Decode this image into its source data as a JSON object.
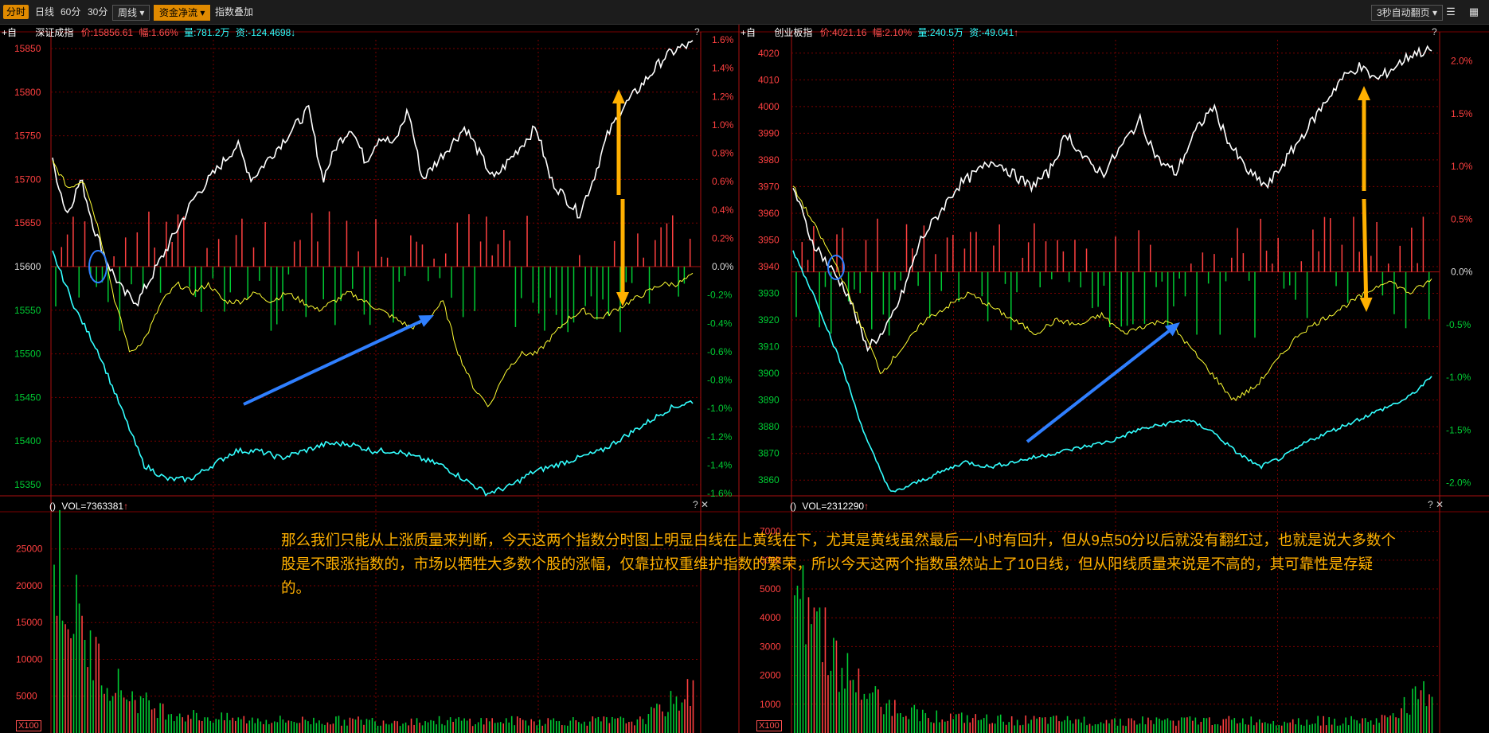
{
  "toolbar": {
    "tabs": [
      "分时",
      "日线",
      "60分",
      "30分"
    ],
    "weekly": "周线",
    "fundflow": "资金净流",
    "overlay": "指数叠加",
    "autopage": "3秒自动翻页"
  },
  "colors": {
    "price": "#ffffff",
    "avg": "#ffff33",
    "breadth": "#33ffff",
    "up": "#ff4040",
    "down": "#00cc33",
    "arrow_blue": "#2f7fff",
    "arrow_orange": "#ffb000",
    "grid": "#7a0000"
  },
  "left": {
    "header_btn": "+自",
    "name": "深证成指",
    "price": "价:15856.61",
    "change": "幅:1.66%",
    "volume": "量:781.2万",
    "fund": "资:-124.4698",
    "fund_arrow": "↓",
    "vol_label": "VOL=7363381",
    "vol_arrow": "↑",
    "y_ticks": [
      "15850",
      "15800",
      "15750",
      "15700",
      "15650",
      "15600",
      "15550",
      "15500",
      "15450",
      "15400",
      "15350"
    ],
    "pct_ticks": [
      "1.6%",
      "1.4%",
      "1.2%",
      "1.0%",
      "0.8%",
      "0.6%",
      "0.4%",
      "0.2%",
      "0.0%",
      "-0.2%",
      "-0.4%",
      "-0.6%",
      "-0.8%",
      "-1.0%",
      "-1.2%",
      "-1.4%",
      "-1.6%"
    ],
    "vol_ticks": [
      "25000",
      "20000",
      "15000",
      "10000",
      "5000"
    ],
    "vol_unit": "X100"
  },
  "right": {
    "header_btn": "+自",
    "name": "创业板指",
    "price": "价:4021.16",
    "change": "幅:2.10%",
    "volume": "量:240.5万",
    "fund": "资:-49.041",
    "fund_arrow": "↑",
    "vol_label": "VOL=2312290",
    "vol_arrow": "↑",
    "y_ticks": [
      "4020",
      "4010",
      "4000",
      "3990",
      "3980",
      "3970",
      "3960",
      "3950",
      "3940",
      "3930",
      "3920",
      "3910",
      "3900",
      "3890",
      "3880",
      "3870",
      "3860"
    ],
    "pct_ticks": [
      "2.0%",
      "1.5%",
      "1.0%",
      "0.5%",
      "0.0%",
      "-0.5%",
      "-1.0%",
      "-1.5%",
      "-2.0%"
    ],
    "vol_ticks": [
      "7000",
      "6000",
      "5000",
      "4000",
      "3000",
      "2000",
      "1000"
    ],
    "vol_unit": "X100"
  },
  "annotation": "那么我们只能从上涨质量来判断，今天这两个指数分时图上明显白线在上黄线在下，尤其是黄线虽然最后一小时有回升，但从9点50分以后就没有翻红过，也就是说大多数个股是不跟涨指数的，市场以牺牲大多数个股的涨幅，仅靠拉权重维护指数的繁荣，所以今天这两个指数虽然站上了10日线，但从阳线质量来说是不高的，其可靠性是存疑的。",
  "chart_data": [
    {
      "type": "line",
      "title": "深证成指",
      "ylim": [
        15340,
        15860
      ],
      "ylim_pct": [
        -1.6,
        1.6
      ],
      "base": 15600,
      "series": [
        {
          "color_key": "price",
          "values": [
            15720,
            15660,
            15700,
            15640,
            15600,
            15570,
            15560,
            15590,
            15620,
            15650,
            15680,
            15700,
            15720,
            15740,
            15700,
            15720,
            15740,
            15760,
            15780,
            15700,
            15740,
            15760,
            15720,
            15750,
            15740,
            15780,
            15700,
            15720,
            15740,
            15760,
            15730,
            15700,
            15720,
            15740,
            15760,
            15700,
            15680,
            15660,
            15700,
            15750,
            15780,
            15800,
            15820,
            15840,
            15850,
            15855
          ]
        },
        {
          "color_key": "avg",
          "values": [
            15720,
            15690,
            15700,
            15640,
            15560,
            15500,
            15520,
            15560,
            15580,
            15570,
            15580,
            15560,
            15560,
            15570,
            15560,
            15570,
            15560,
            15550,
            15560,
            15570,
            15560,
            15550,
            15540,
            15530,
            15540,
            15560,
            15500,
            15460,
            15440,
            15480,
            15500,
            15500,
            15520,
            15540,
            15550,
            15540,
            15550,
            15560,
            15570,
            15580,
            15580,
            15590
          ]
        },
        {
          "color_key": "breadth",
          "values": [
            0.1,
            -0.3,
            -0.6,
            -1.0,
            -1.4,
            -1.5,
            -1.5,
            -1.4,
            -1.3,
            -1.3,
            -1.35,
            -1.3,
            -1.25,
            -1.25,
            -1.3,
            -1.3,
            -1.35,
            -1.4,
            -1.5,
            -1.6,
            -1.55,
            -1.45,
            -1.4,
            -1.35,
            -1.3,
            -1.2,
            -1.1,
            -1.0,
            -0.95
          ]
        }
      ]
    },
    {
      "type": "line",
      "title": "创业板指",
      "ylim": [
        3855,
        4025
      ],
      "ylim_pct": [
        -2.1,
        2.2
      ],
      "base": 3939,
      "series": [
        {
          "color_key": "price",
          "values": [
            3970,
            3950,
            3940,
            3930,
            3910,
            3915,
            3930,
            3950,
            3960,
            3970,
            3975,
            3980,
            3975,
            3970,
            3975,
            3990,
            3980,
            3975,
            3985,
            3995,
            3980,
            3975,
            3990,
            4000,
            3985,
            3975,
            3970,
            3980,
            3990,
            4000,
            4010,
            4015,
            4010,
            4015,
            4020,
            4021
          ]
        },
        {
          "color_key": "avg",
          "values": [
            3970,
            3955,
            3940,
            3920,
            3900,
            3910,
            3920,
            3925,
            3930,
            3925,
            3920,
            3915,
            3920,
            3918,
            3922,
            3915,
            3918,
            3920,
            3910,
            3900,
            3890,
            3895,
            3905,
            3915,
            3920,
            3925,
            3930,
            3935,
            3930,
            3935
          ]
        },
        {
          "color_key": "breadth",
          "values": [
            0.2,
            -0.3,
            -0.9,
            -1.6,
            -2.1,
            -2.0,
            -1.9,
            -1.8,
            -1.85,
            -1.8,
            -1.75,
            -1.7,
            -1.65,
            -1.6,
            -1.5,
            -1.45,
            -1.4,
            -1.5,
            -1.7,
            -1.85,
            -1.75,
            -1.6,
            -1.5,
            -1.4,
            -1.3,
            -1.2,
            -1.0
          ]
        }
      ]
    }
  ]
}
